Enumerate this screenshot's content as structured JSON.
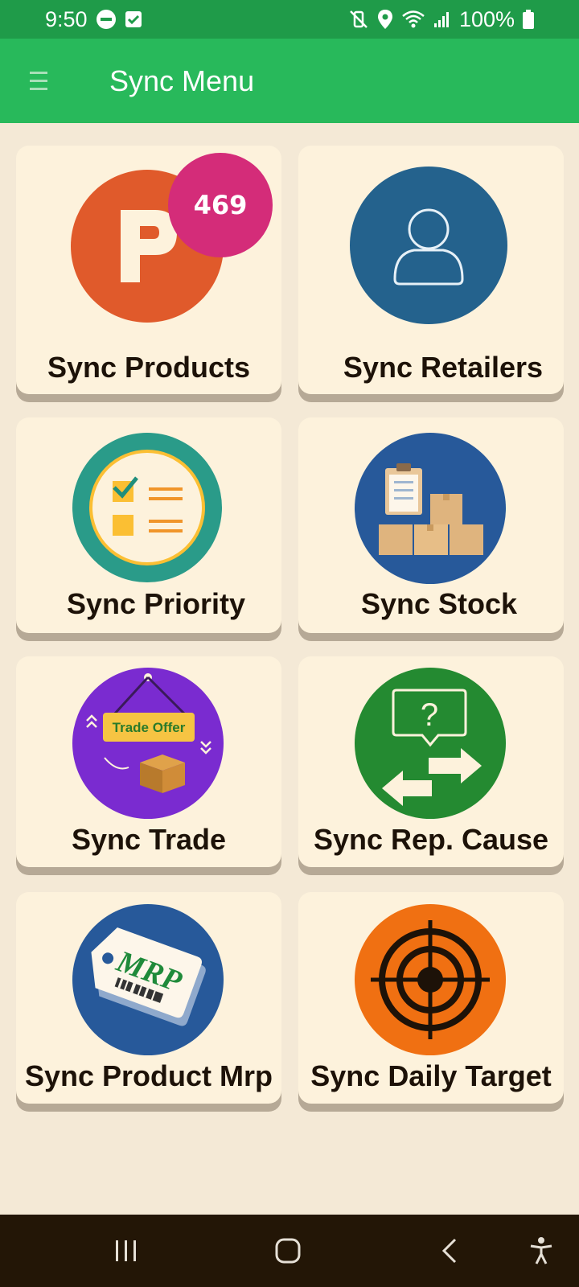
{
  "status_bar": {
    "time": "9:50",
    "battery": "100%"
  },
  "app_bar": {
    "title": "Sync Menu",
    "menu_icon": "hamburger-icon"
  },
  "cards": [
    {
      "label": "Sync Products",
      "icon": "products-p-icon",
      "badge": "469",
      "color": "#e05a2b"
    },
    {
      "label": "Sync Retailers",
      "icon": "retailer-person-icon",
      "color": "#24628d"
    },
    {
      "label": "Sync Priority",
      "icon": "priority-checklist-icon",
      "color": "#2a9b89"
    },
    {
      "label": "Sync Stock",
      "icon": "stock-boxes-icon",
      "color": "#27599a"
    },
    {
      "label": "Sync Trade",
      "icon": "trade-offer-icon",
      "color": "#7a2bd0"
    },
    {
      "label": "Sync Rep. Cause",
      "icon": "rep-cause-exchange-icon",
      "color": "#248a31"
    },
    {
      "label": "Sync Product Mrp",
      "icon": "mrp-tag-icon",
      "color": "#27599a"
    },
    {
      "label": "Sync Daily Target",
      "icon": "target-icon",
      "color": "#f07012"
    }
  ],
  "nav_bar": {
    "recents_icon": "recents-icon",
    "home_icon": "home-icon",
    "back_icon": "back-icon",
    "accessibility_icon": "accessibility-icon"
  }
}
